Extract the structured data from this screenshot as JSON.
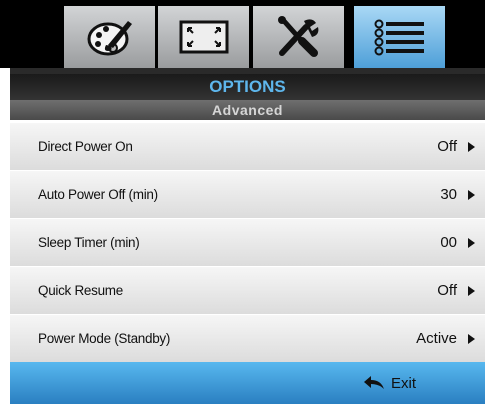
{
  "tabs": [
    {
      "icon": "palette-icon",
      "active": false
    },
    {
      "icon": "screen-resize-icon",
      "active": false
    },
    {
      "icon": "tools-icon",
      "active": false
    },
    {
      "icon": "list-settings-icon",
      "active": true
    }
  ],
  "header": {
    "title": "OPTIONS",
    "subtitle": "Advanced"
  },
  "menu": {
    "items": [
      {
        "label": "Direct Power On",
        "value": "Off"
      },
      {
        "label": "Auto Power Off (min)",
        "value": "30"
      },
      {
        "label": "Sleep Timer (min)",
        "value": "00"
      },
      {
        "label": "Quick Resume",
        "value": "Off"
      },
      {
        "label": "Power Mode (Standby)",
        "value": "Active"
      }
    ]
  },
  "footer": {
    "exit_label": "Exit"
  },
  "colors": {
    "accent": "#5eb6ec",
    "footer_top": "#58b8ef",
    "footer_bottom": "#2a7fc1",
    "tab_active": "#4e9fd8"
  }
}
